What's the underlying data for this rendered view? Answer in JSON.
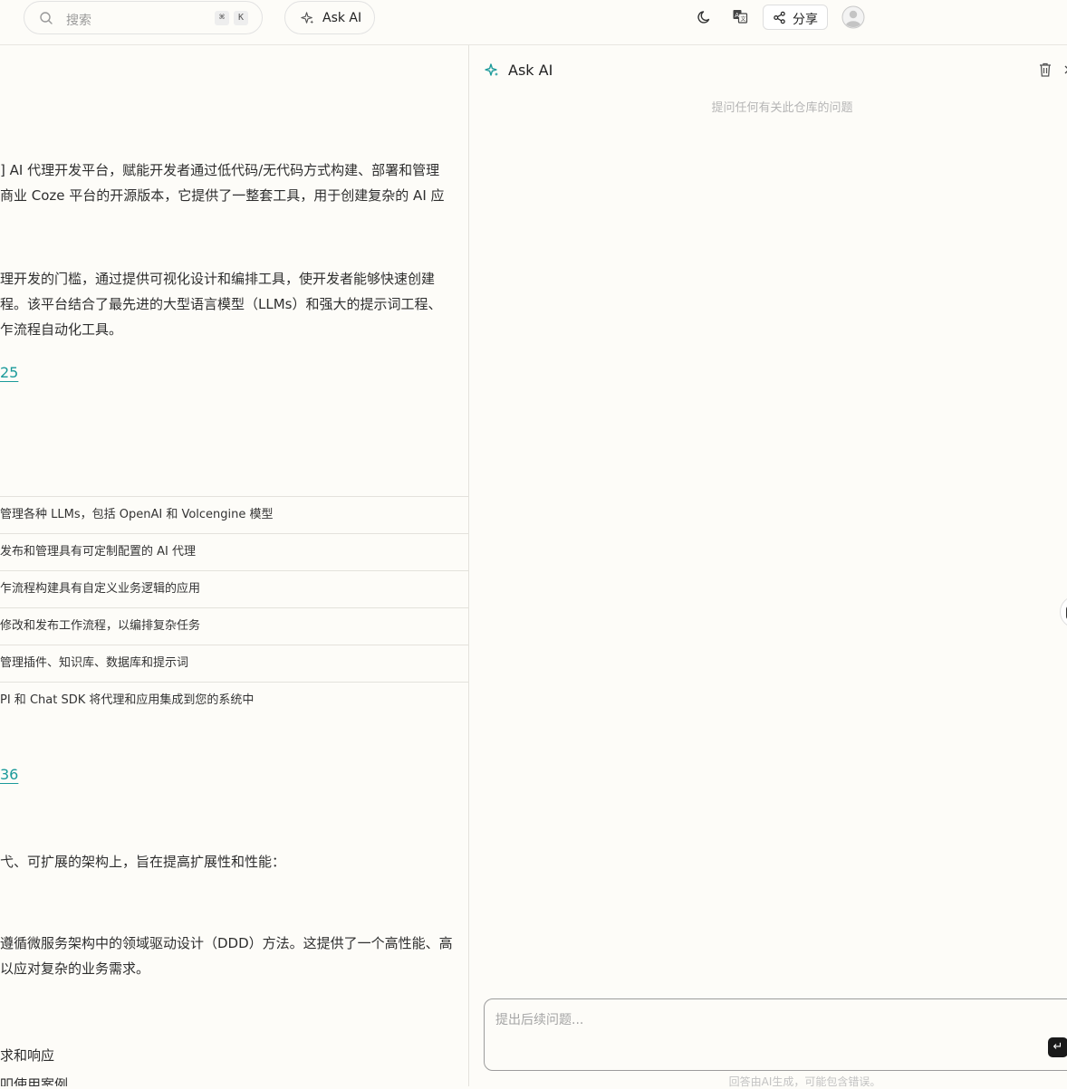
{
  "topbar": {
    "search_placeholder": "搜索",
    "kbd_cmd": "⌘",
    "kbd_k": "K",
    "ask_ai_label": "Ask AI",
    "share_label": "分享"
  },
  "doc": {
    "paragraphs": [
      "] AI 代理开发平台，赋能开发者通过低代码/无代码方式构建、部署和管理",
      "商业 Coze 平台的开源版本，它提供了一整套工具，用于创建复杂的 AI 应",
      "理开发的门槛，通过提供可视化设计和编排工具，使开发者能够快速创建",
      "程。该平台结合了最先进的大型语言模型（LLMs）和强大的提示词工程、",
      "乍流程自动化工具。"
    ],
    "link1": "25",
    "table_rows": [
      "管理各种 LLMs，包括 OpenAI 和 Volcengine 模型",
      "发布和管理具有可定制配置的 AI 代理",
      "乍流程构建具有自定义业务逻辑的应用",
      "修改和发布工作流程，以编排复杂任务",
      "管理插件、知识库、数据库和提示词",
      "PI 和 Chat SDK 将代理和应用集成到您的系统中"
    ],
    "link2": "36",
    "para_arch": "弋、可扩展的架构上，旨在提高扩展性和性能：",
    "para_ddd_1": "遵循微服务架构中的领域驱动设计（DDD）方法。这提供了一个高性能、高",
    "para_ddd_2": "以应对复杂的业务需求。",
    "para_req": "求和响应",
    "para_cases": "叩使用案例"
  },
  "panel": {
    "title": "Ask AI",
    "hint": "提问任何有关此仓库的问题",
    "input_placeholder": "提出后续问题...",
    "send_icon": "↵",
    "disclaimer": "回答由AI生成，可能包含错误。"
  }
}
